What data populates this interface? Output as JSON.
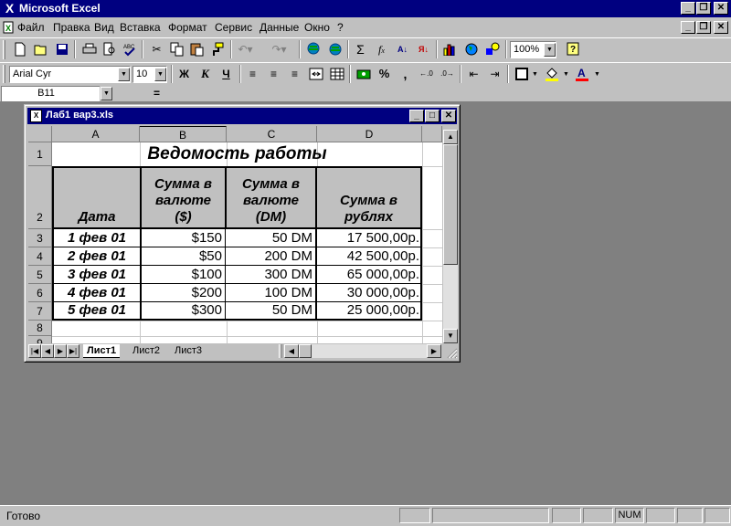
{
  "app": {
    "title": "Microsoft Excel"
  },
  "menu": [
    "Файл",
    "Правка",
    "Вид",
    "Вставка",
    "Формат",
    "Сервис",
    "Данные",
    "Окно",
    "?"
  ],
  "toolbar": {
    "zoom": "100%"
  },
  "format_toolbar": {
    "font": "Arial Cyr",
    "size": "10",
    "bold": "Ж",
    "italic": "К",
    "underline": "Ч",
    "percent": "%",
    "comma": ","
  },
  "formula_bar": {
    "cell_ref": "B11",
    "equals": "=",
    "value": ""
  },
  "workbook": {
    "title": "Лаб1 вар3.xls",
    "columns": [
      "A",
      "B",
      "C",
      "D"
    ],
    "rows": [
      "1",
      "2",
      "3",
      "4",
      "5",
      "6",
      "7",
      "8",
      "9"
    ],
    "sheet_title": "Ведомость работы",
    "headers": {
      "date": "Дата",
      "usd": [
        "Сумма в",
        "валюте",
        "($)"
      ],
      "dm": [
        "Сумма в",
        "валюте",
        "(DM)"
      ],
      "rub": [
        "Сумма в",
        "рублях"
      ]
    },
    "data": [
      {
        "date": "1 фев 01",
        "usd": "$150",
        "dm": "50 DM",
        "rub": "17 500,00р."
      },
      {
        "date": "2 фев 01",
        "usd": "$50",
        "dm": "200 DM",
        "rub": "42 500,00р."
      },
      {
        "date": "3 фев 01",
        "usd": "$100",
        "dm": "300 DM",
        "rub": "65 000,00р."
      },
      {
        "date": "4 фев 01",
        "usd": "$200",
        "dm": "100 DM",
        "rub": "30 000,00р."
      },
      {
        "date": "5 фев 01",
        "usd": "$300",
        "dm": "50 DM",
        "rub": "25 000,00р."
      }
    ],
    "sheets": [
      "Лист1",
      "Лист2",
      "Лист3"
    ],
    "active_sheet": "Лист1"
  },
  "status": {
    "text": "Готово",
    "num": "NUM"
  }
}
